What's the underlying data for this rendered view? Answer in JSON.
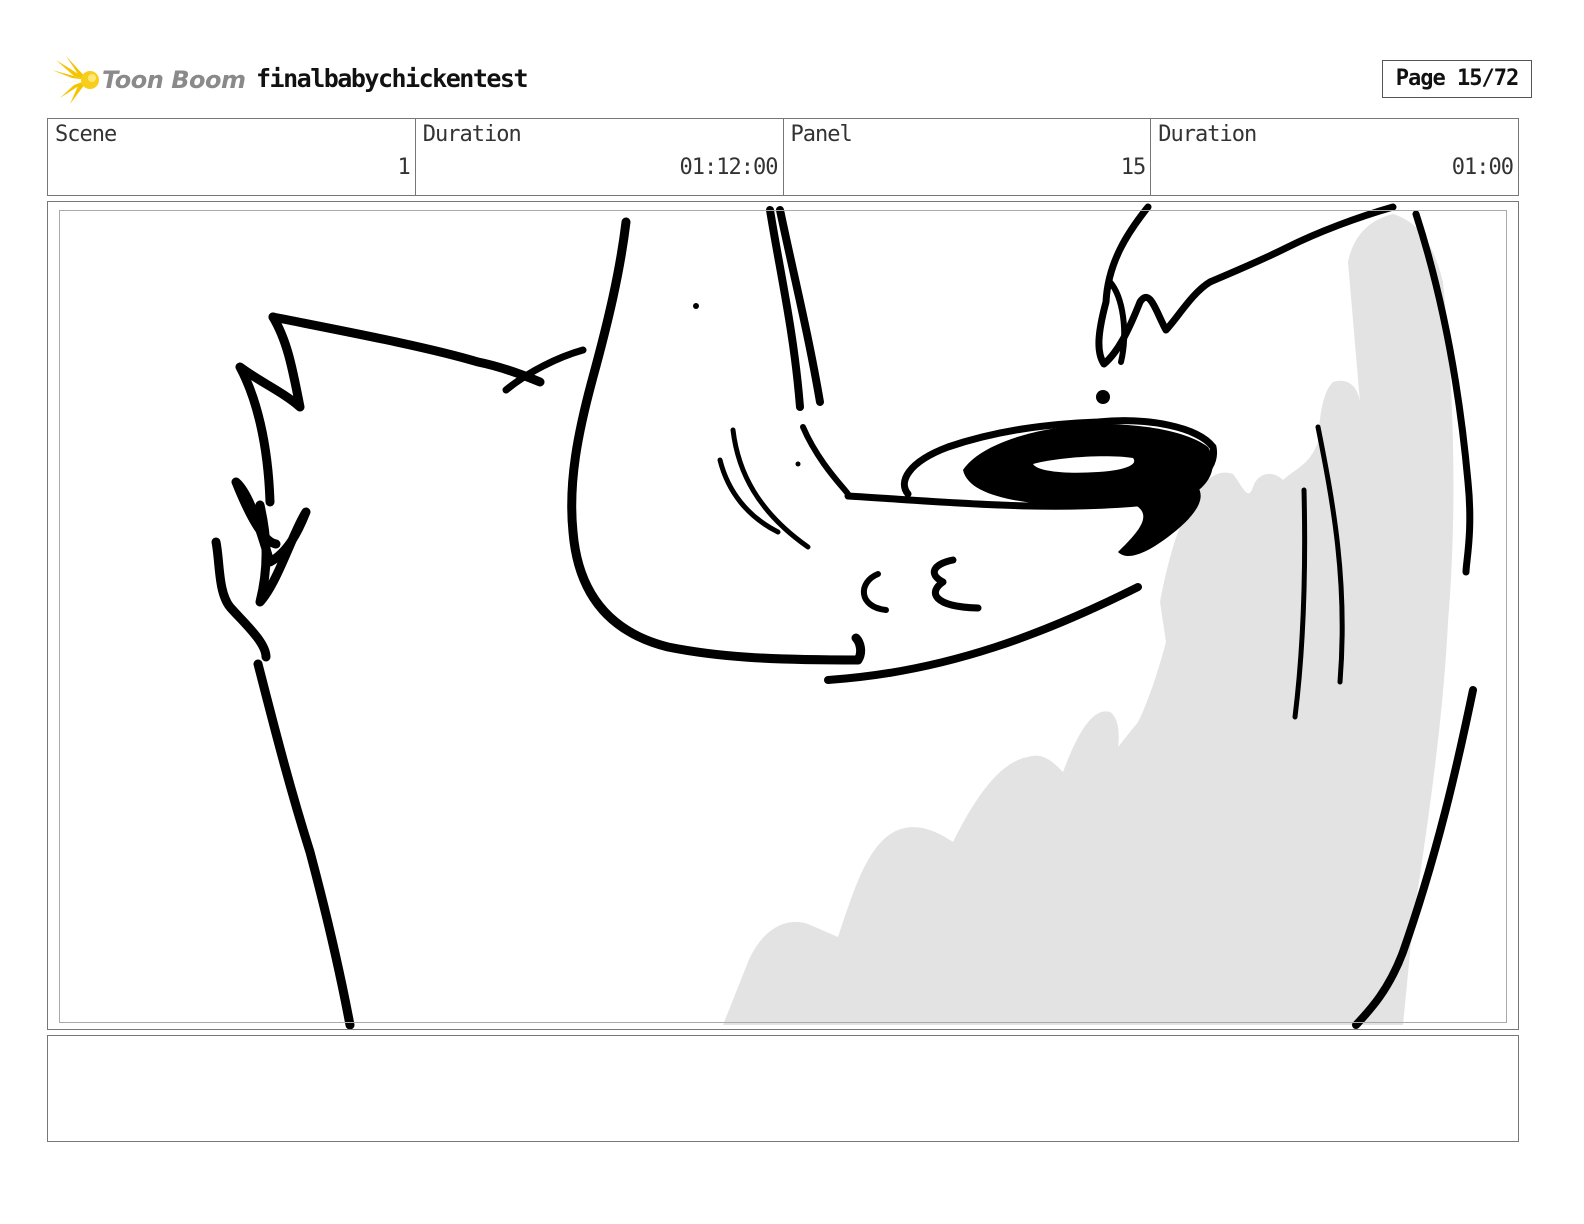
{
  "header": {
    "logo_text": "Toon Boom",
    "project_title": "finalbabychickentest",
    "page_indicator": "Page 15/72"
  },
  "info": [
    {
      "label": "Scene",
      "value": "1"
    },
    {
      "label": "Duration",
      "value": "01:12:00"
    },
    {
      "label": "Panel",
      "value": "15"
    },
    {
      "label": "Duration",
      "value": "01:00"
    }
  ],
  "colors": {
    "logo_accent": "#f5c400",
    "sketch_ink": "#000000",
    "sketch_shadow": "#e3e3e3"
  },
  "notes": {
    "text": ""
  }
}
